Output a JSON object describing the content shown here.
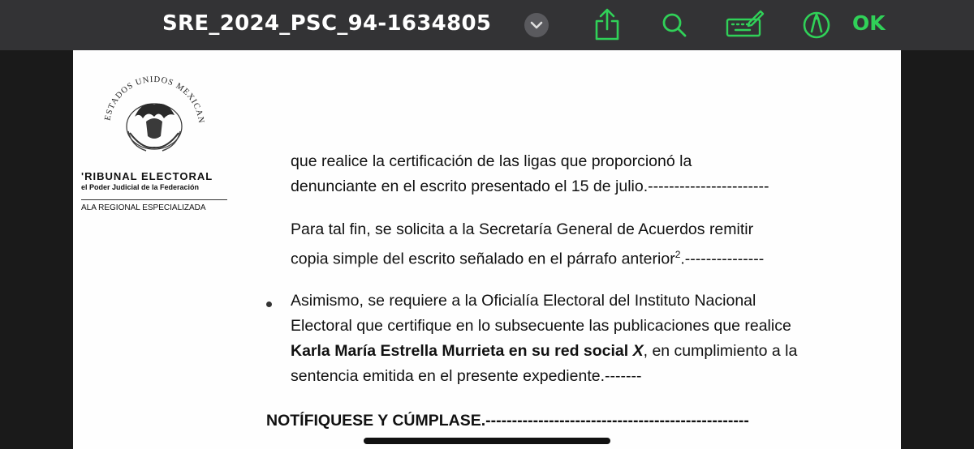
{
  "toolbar": {
    "title": "SRE_2024_PSC_94-1634805",
    "ok_label": "OK",
    "accent_color": "#30d158",
    "icons": [
      "chevron-down-icon",
      "share-icon",
      "search-icon",
      "keyboard-pen-icon",
      "markup-pen-icon"
    ]
  },
  "document": {
    "header": {
      "seal_text": "ESTADOS UNIDOS MEXICANOS",
      "court_name": "'RIBUNAL ELECTORAL",
      "court_sub": "el Poder Judicial de la Federación",
      "court_room": "ALA REGIONAL ESPECIALIZADA"
    },
    "paragraphs": [
      {
        "line1": "que realice la certificación de las ligas que proporcionó la",
        "line2": "denunciante en el escrito presentado el 15 de julio.-----------------------"
      },
      {
        "line1": "Para tal fin, se solicita a la Secretaría General de Acuerdos remitir",
        "line2_text": "copia simple del escrito señalado en el párrafo anterior",
        "footnote": "2",
        "line2_tail": ".---------------"
      },
      {
        "lines_before": "Asimismo, se requiere a la Oficialía Electoral del Instituto Nacional Electoral que certifique en lo subsecuente las publicaciones que realice ",
        "bold_text": "Karla María Estrella Murrieta en su red social ",
        "bold_italic": "X",
        "tail": ", en cumplimiento a la sentencia emitida en el presente expediente.-------"
      }
    ],
    "closing": "NOTÍFIQUESE Y CÚMPLASE.--------------------------------------------------"
  }
}
